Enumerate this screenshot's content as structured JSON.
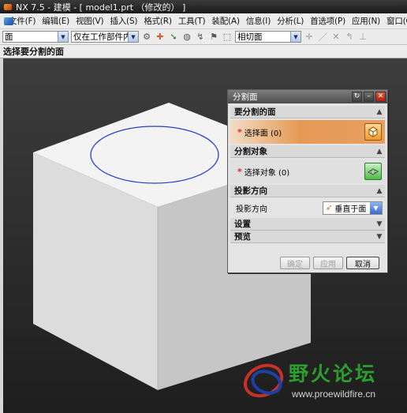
{
  "window": {
    "title": "NX 7.5 - 建模 - [ model1.prt （修改的） ]"
  },
  "menu": {
    "items": [
      "文件(F)",
      "编辑(E)",
      "视图(V)",
      "插入(S)",
      "格式(R)",
      "工具(T)",
      "装配(A)",
      "信息(I)",
      "分析(L)",
      "首选项(P)",
      "应用(N)",
      "窗口(O)"
    ]
  },
  "toolbar": {
    "filter_value": "面",
    "scope_value": "仅在工作部件内部",
    "view_value": "相切面"
  },
  "status": {
    "prompt": "选择要分割的面"
  },
  "dialog": {
    "title": "分割面",
    "sections": {
      "face": {
        "header": "要分割的面",
        "label": "选择面 (0)"
      },
      "object": {
        "header": "分割对象",
        "label": "选择对象 (0)"
      },
      "projection": {
        "header": "投影方向",
        "label": "投影方向",
        "value": "垂直于面"
      },
      "settings": {
        "header": "设置"
      },
      "preview": {
        "header": "预览"
      }
    },
    "buttons": {
      "ok": "确定",
      "apply": "应用",
      "cancel": "取消"
    }
  },
  "watermark": {
    "brand": "野火论坛",
    "url": "www.proewildfire.cn"
  },
  "colors": {
    "accent": "#e59a55",
    "titlebar": "#1a1a1a",
    "close": "#c22a14",
    "ellipse": "#2a3fd0"
  },
  "icons": [
    "nx-logo-icon",
    "filter-icon",
    "arrow-icon",
    "cube-select-icon",
    "face-select-icon",
    "normal-direction-icon",
    "reset-icon",
    "minimize-icon",
    "close-icon",
    "chevron-up-icon",
    "chevron-down-icon"
  ]
}
